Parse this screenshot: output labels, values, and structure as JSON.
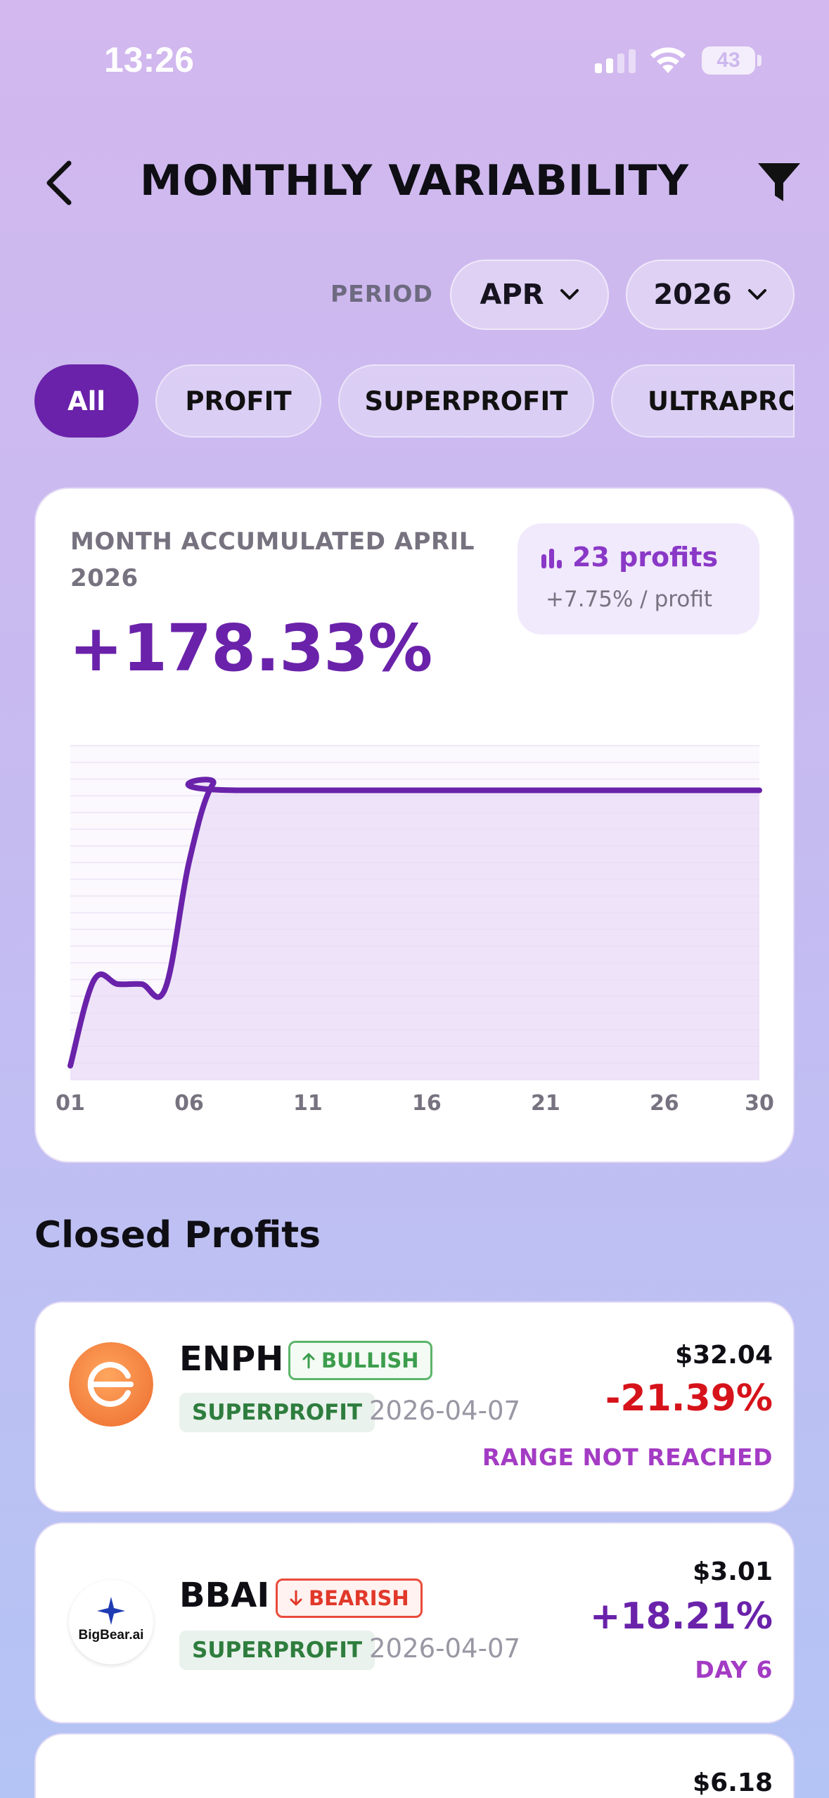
{
  "status_bar": {
    "time": "13:26",
    "battery": "43"
  },
  "header": {
    "title": "MONTHLY VARIABILITY"
  },
  "period": {
    "label": "PERIOD",
    "month": "APR",
    "year": "2026"
  },
  "filters": [
    "All",
    "PROFIT",
    "SUPERPROFIT",
    "ULTRAPROFIT"
  ],
  "summary": {
    "label": "MONTH ACCUMULATED APRIL 2026",
    "value": "+178.33%",
    "badge_count": "23 profits",
    "badge_avg": "+7.75% / profit"
  },
  "chart_data": {
    "type": "area",
    "x_ticks": [
      "01",
      "06",
      "11",
      "16",
      "21",
      "26",
      "30"
    ],
    "x": [
      1,
      2,
      3,
      4,
      5,
      6,
      7,
      8,
      30
    ],
    "values": [
      0,
      42,
      40,
      40,
      38,
      100,
      138,
      135,
      135
    ],
    "xlim": [
      1,
      30
    ],
    "grid": true,
    "colors": {
      "line": "#6a22aa",
      "fill": "#e9dcf5"
    }
  },
  "section": {
    "title": "Closed Profits"
  },
  "profits": [
    {
      "ticker": "ENPH",
      "direction": "BULLISH",
      "tier": "SUPERPROFIT",
      "date": "2026-04-07",
      "price": "$32.04",
      "change": "-21.39%",
      "note": "RANGE NOT REACHED"
    },
    {
      "ticker": "BBAI",
      "direction": "BEARISH",
      "tier": "SUPERPROFIT",
      "date": "2026-04-07",
      "price": "$3.01",
      "change": "+18.21%",
      "note": "DAY 6",
      "logo_text": "BigBear.ai"
    },
    {
      "price": "$6.18"
    }
  ]
}
